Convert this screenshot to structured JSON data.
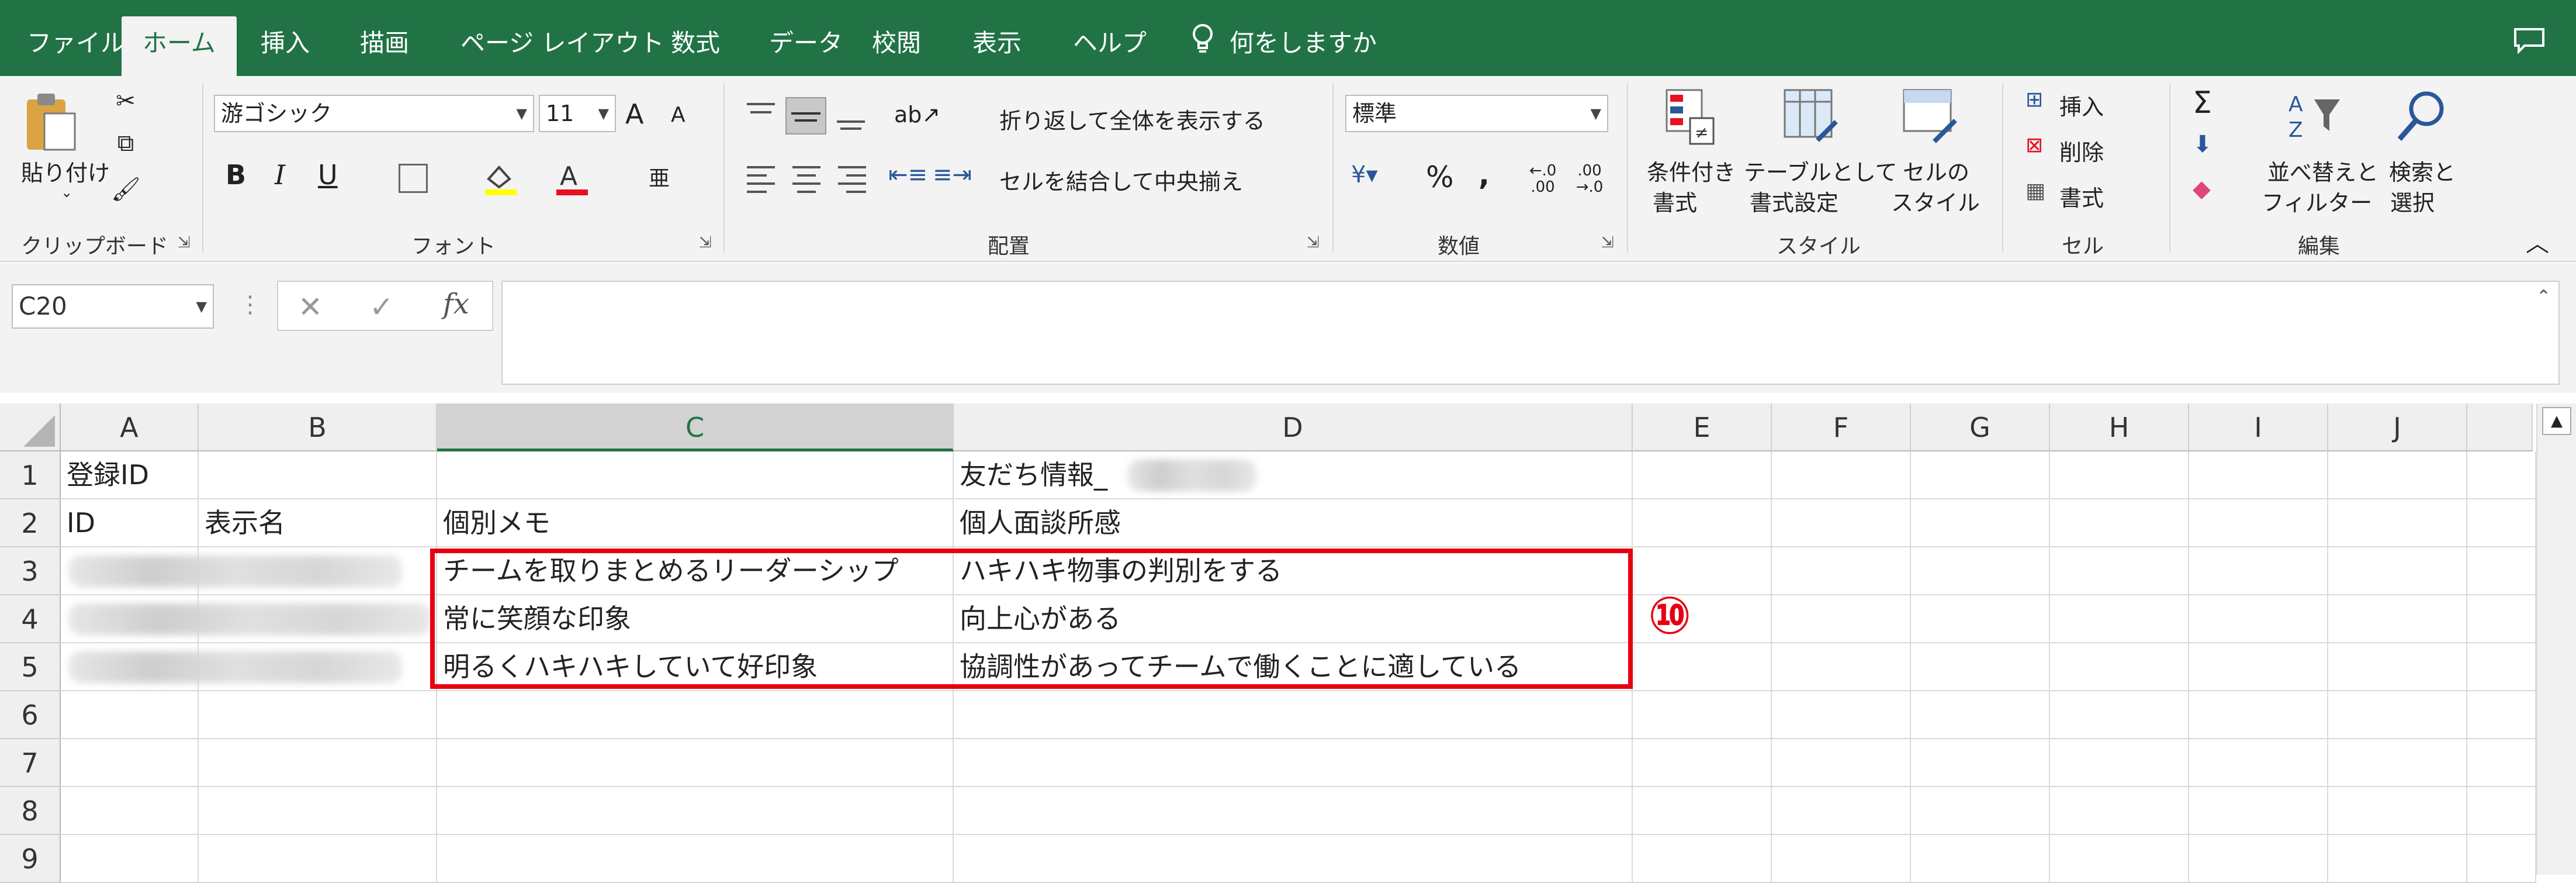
{
  "tabs": [
    "ファイル",
    "ホーム",
    "挿入",
    "描画",
    "ページ レイアウト",
    "数式",
    "データ",
    "校閲",
    "表示",
    "ヘルプ"
  ],
  "tell_me": "何をしますか",
  "clipboard": {
    "paste": "貼り付け",
    "group": "クリップボード"
  },
  "font": {
    "name": "游ゴシック",
    "size": "11",
    "group": "フォント",
    "bold": "B",
    "italic": "I",
    "underline": "U",
    "grow": "A",
    "shrink": "A"
  },
  "alignment": {
    "wrap": "折り返して全体を表示する",
    "merge": "セルを結合して中央揃え",
    "group": "配置"
  },
  "number": {
    "format": "標準",
    "percent": "%",
    "comma": ",",
    "inc_decimal": "←.0 .00",
    "dec_decimal": ".00 →.0",
    "group": "数値"
  },
  "styles": {
    "conditional_1": "条件付き",
    "conditional_2": "書式",
    "table_1": "テーブルとして",
    "table_2": "書式設定",
    "cell_1": "セルの",
    "cell_2": "スタイル",
    "group": "スタイル"
  },
  "cells": {
    "insert": "挿入",
    "delete": "削除",
    "format": "書式",
    "group": "セル"
  },
  "editing": {
    "sort_1": "並べ替えと",
    "sort_2": "フィルター",
    "find_1": "検索と",
    "find_2": "選択",
    "group": "編集"
  },
  "formula_bar": {
    "name_box": "C20",
    "fx": "fx",
    "content": ""
  },
  "columns": [
    "A",
    "B",
    "C",
    "D",
    "E",
    "F",
    "G",
    "H",
    "I",
    "J"
  ],
  "rows": [
    "1",
    "2",
    "3",
    "4",
    "5",
    "6",
    "7",
    "8",
    "9"
  ],
  "cells_data": {
    "A1": "登録ID",
    "D1": "友だち情報_",
    "A2": "ID",
    "B2": "表示名",
    "C2": "個別メモ",
    "D2": "個人面談所感",
    "C3": "チームを取りまとめるリーダーシップ",
    "D3": "ハキハキ物事の判別をする",
    "C4": "常に笑顔な印象",
    "D4": "向上心がある",
    "C5": "明るくハキハキしていて好印象",
    "D5": "協調性があってチームで働くことに適している"
  },
  "annotation": {
    "label": "⑩",
    "color": "#e60012"
  },
  "colors": {
    "accent": "#217346",
    "ribbon": "#f3f3f3",
    "highlight": "#e60012"
  }
}
